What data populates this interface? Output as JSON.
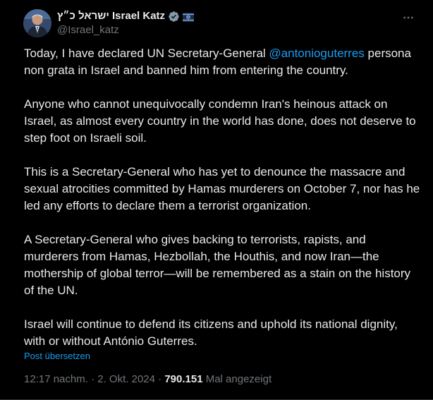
{
  "author": {
    "name": "ישראל כ״ץ Israel Katz",
    "handle": "@Israel_katz"
  },
  "post": {
    "paragraphs": [
      {
        "before": "Today, I have declared UN Secretary-General ",
        "mention": "@antonioguterres",
        "after": " persona non grata in Israel and banned him from entering the country."
      },
      {
        "text": "Anyone who cannot unequivocally condemn Iran's heinous attack on Israel, as almost every country in the world has done, does not deserve to step foot on Israeli soil."
      },
      {
        "text": "This is a Secretary-General who has yet to denounce the massacre and sexual atrocities committed by Hamas murderers on October 7, nor has he led any efforts to declare them a terrorist organization."
      },
      {
        "text": "A Secretary-General who gives backing to terrorists, rapists, and murderers from Hamas, Hezbollah, the Houthis, and now Iran—the mothership of global terror—will be remembered as a stain on the history of the UN."
      },
      {
        "text": "Israel will continue to defend its citizens and uphold its national dignity, with or without António Guterres."
      }
    ],
    "translate_label": "Post übersetzen"
  },
  "meta": {
    "time": "12:17 nachm.",
    "separator": " · ",
    "date": "2. Okt. 2024",
    "views_count": "790.151",
    "views_label": " Mal angezeigt"
  },
  "colors": {
    "background": "#000000",
    "text": "#e7e9ea",
    "secondary": "#71767b",
    "accent": "#1d9bf0",
    "verified_badge": "#829aab"
  },
  "icons": {
    "verified": "verified-badge-icon",
    "flag": "israel-flag-icon",
    "more": "more-options-icon"
  }
}
